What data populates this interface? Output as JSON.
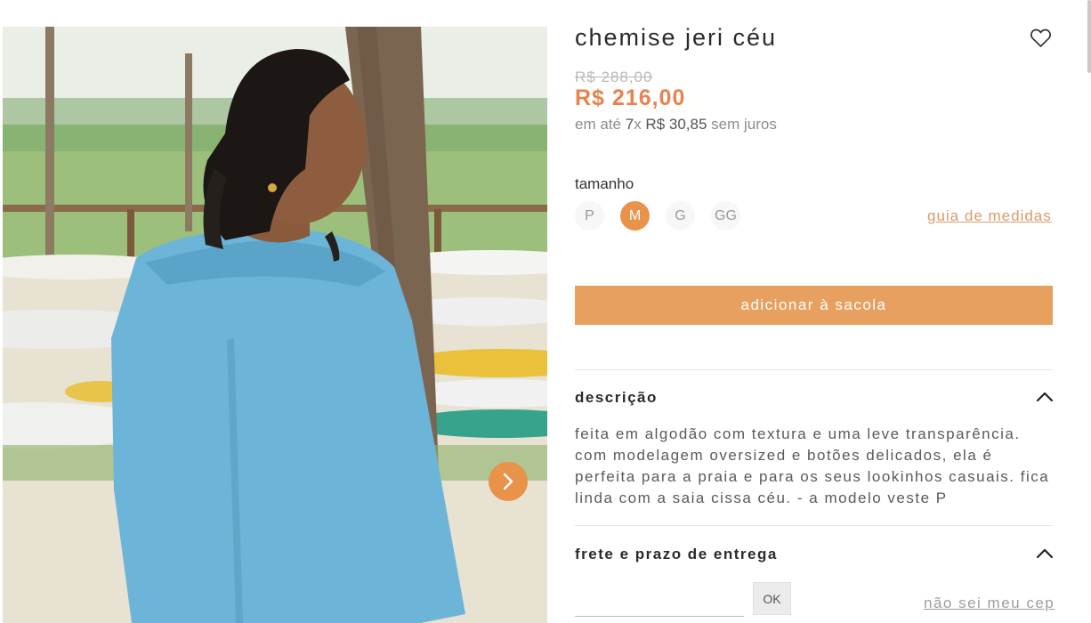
{
  "product": {
    "title": "chemise jeri céu",
    "old_price": "R$ 288,00",
    "price": "R$ 216,00",
    "installments": {
      "prefix": "em até",
      "count": "7",
      "times": "x",
      "amount": "R$ 30,85",
      "suffix": "sem juros"
    }
  },
  "size": {
    "label": "tamanho",
    "options": [
      "P",
      "M",
      "G",
      "GG"
    ],
    "selected": "M",
    "guide_label": "guia de medidas"
  },
  "add_to_bag_label": "adicionar à sacola",
  "description": {
    "title": "descrição",
    "text": "feita em algodão com textura e uma leve transparência. com modelagem oversized e botões delicados, ela é perfeita para a praia e para os seus lookinhos casuais. fica linda com a saia cissa céu. - a modelo veste P"
  },
  "shipping": {
    "title": "frete e prazo de entrega",
    "cep_value": "",
    "ok_label": "OK",
    "no_cep_label": "não sei meu cep"
  },
  "icons": {
    "favorite": "heart-icon",
    "next": "chevron-right-icon",
    "collapse": "chevron-up-icon"
  },
  "colors": {
    "accent": "#e8924a",
    "price": "#e8824e",
    "button": "#e8a060"
  }
}
